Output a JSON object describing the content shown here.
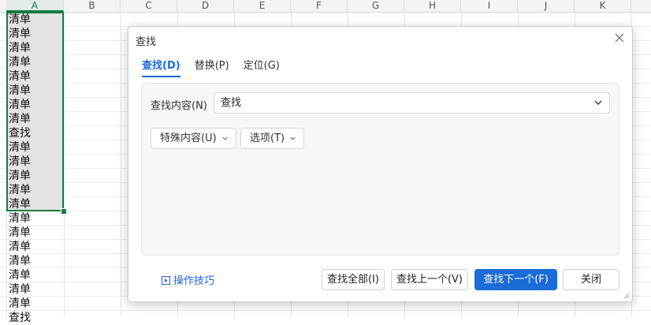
{
  "sheet": {
    "columns": [
      "A",
      "B",
      "C",
      "D",
      "E",
      "F",
      "G",
      "H",
      "I",
      "J",
      "K"
    ],
    "selected_column": "A",
    "cells": [
      "清单",
      "清单",
      "清单",
      "清单",
      "清单",
      "清单",
      "清单",
      "清单",
      "查找",
      "清单",
      "清单",
      "清单",
      "清单",
      "清单",
      "清单",
      "清单",
      "清单",
      "清单",
      "清单",
      "清单",
      "清单",
      "查找"
    ]
  },
  "dialog": {
    "title": "查找",
    "tabs": [
      "查找(D)",
      "替换(P)",
      "定位(G)"
    ],
    "active_tab": 0,
    "find_label": "查找内容(N)",
    "find_value": "查找",
    "special_label": "特殊内容(U)",
    "options_label": "选项(T)",
    "tips_label": "操作技巧",
    "buttons": {
      "find_all": "查找全部(I)",
      "find_prev": "查找上一个(V)",
      "find_next": "查找下一个(F)",
      "close": "关闭"
    }
  },
  "colors": {
    "accent": "#1b6bd8",
    "selection": "#107c41"
  }
}
